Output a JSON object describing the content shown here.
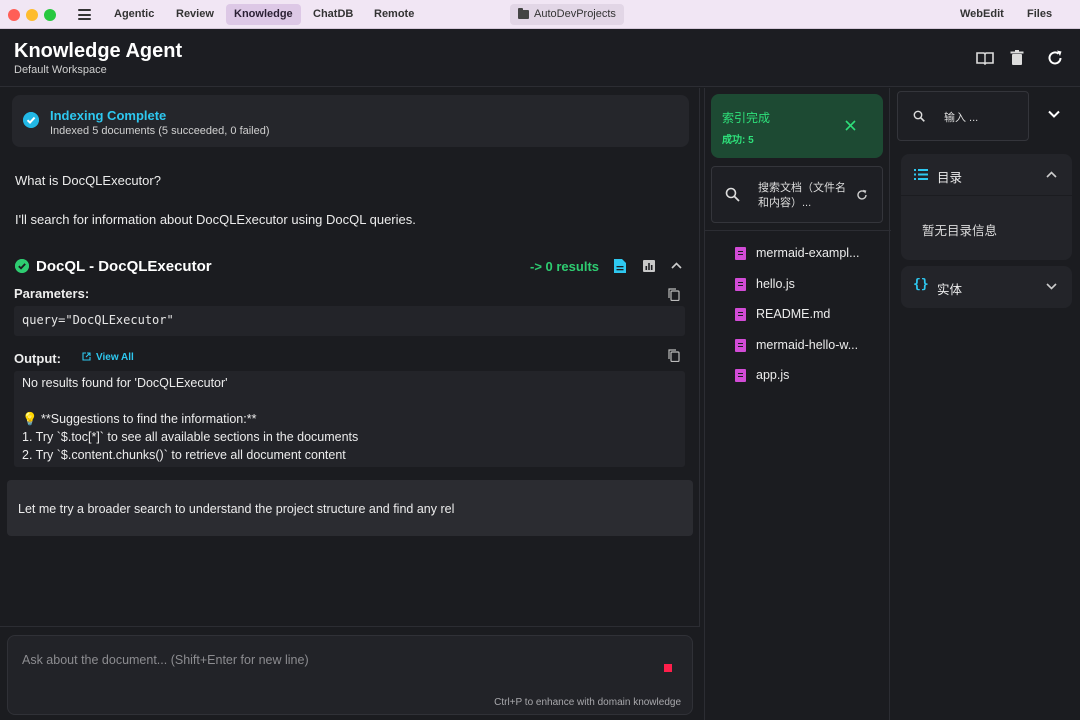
{
  "titlebar": {
    "tabs": [
      "Agentic",
      "Review",
      "Knowledge",
      "ChatDB",
      "Remote"
    ],
    "active_tab": "Knowledge",
    "project": "AutoDevProjects",
    "right_items": [
      "WebEdit",
      "Files"
    ]
  },
  "header": {
    "title": "Knowledge Agent",
    "subtitle": "Default Workspace"
  },
  "indexing": {
    "title": "Indexing Complete",
    "subtitle": "Indexed 5 documents (5 succeeded, 0 failed)"
  },
  "chat": {
    "user_question": "What is DocQLExecutor?",
    "assistant_intro": "I'll search for information about DocQLExecutor using DocQL queries.",
    "tool": {
      "title": "DocQL - DocQLExecutor",
      "result_summary": "-> 0 results",
      "parameters_label": "Parameters:",
      "parameters_value": "query=\"DocQLExecutor\"",
      "output_label": "Output:",
      "view_all_label": "View All",
      "output_lines": [
        "No results found for 'DocQLExecutor'",
        "",
        "💡 **Suggestions to find the information:**",
        "1. Try `$.toc[*]` to see all available sections in the documents",
        "2. Try `$.content.chunks()` to retrieve all document content"
      ]
    },
    "assistant_followup": "Let me try a broader search to understand the project structure and find any rel"
  },
  "input": {
    "placeholder": "Ask about the document... (Shift+Enter for new line)",
    "hint": "Ctrl+P to enhance with domain knowledge"
  },
  "docs_panel": {
    "status_title": "索引完成",
    "status_sub": "成功: 5",
    "search_placeholder": "搜索文档（文件名和内容）...",
    "files": [
      "mermaid-exampl...",
      "hello.js",
      "README.md",
      "mermaid-hello-w...",
      "app.js"
    ]
  },
  "right_panel": {
    "search_placeholder": "输入 ...",
    "toc_title": "目录",
    "toc_empty": "暂无目录信息",
    "entities_title": "实体"
  },
  "colors": {
    "accent_cyan": "#2ec8f0",
    "success_green": "#2ecc71",
    "file_icon": "#d24bd6",
    "stop_red": "#ff1f4b"
  }
}
